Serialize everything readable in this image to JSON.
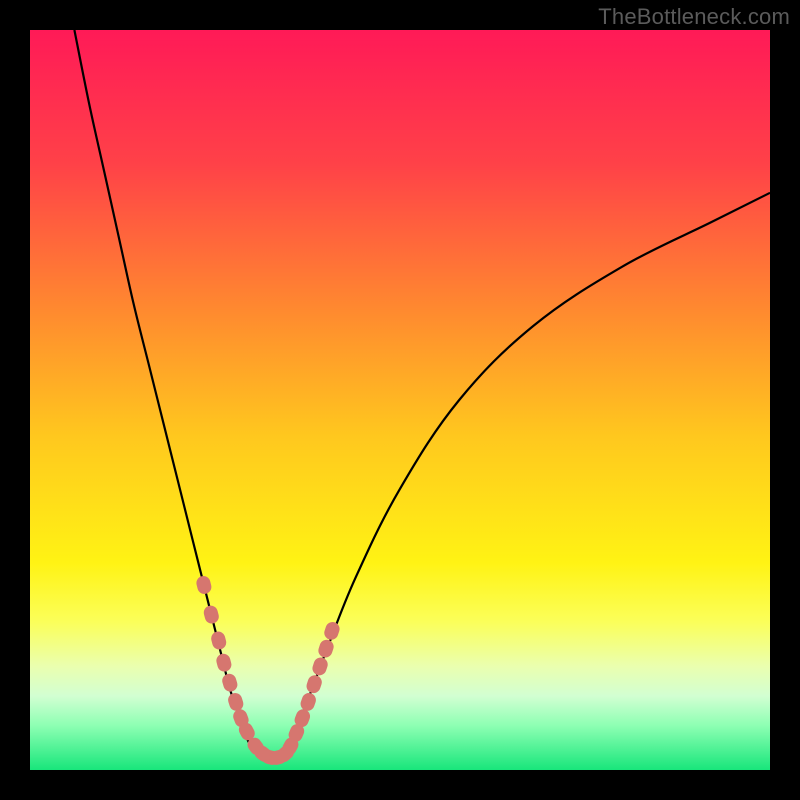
{
  "watermark": "TheBottleneck.com",
  "colors": {
    "black": "#000000",
    "curve": "#000000",
    "marker": "#d6766f",
    "gradient_stops": [
      {
        "pos": 0.0,
        "color": "#ff1a57"
      },
      {
        "pos": 0.18,
        "color": "#ff4148"
      },
      {
        "pos": 0.38,
        "color": "#ff8a2f"
      },
      {
        "pos": 0.55,
        "color": "#ffc81e"
      },
      {
        "pos": 0.72,
        "color": "#fff314"
      },
      {
        "pos": 0.8,
        "color": "#fbff5a"
      },
      {
        "pos": 0.86,
        "color": "#eaffaf"
      },
      {
        "pos": 0.9,
        "color": "#d2ffd2"
      },
      {
        "pos": 0.94,
        "color": "#8dffb3"
      },
      {
        "pos": 1.0,
        "color": "#18e67b"
      }
    ]
  },
  "chart_data": {
    "type": "line",
    "title": "",
    "xlabel": "",
    "ylabel": "",
    "xlim": [
      0,
      100
    ],
    "ylim": [
      0,
      100
    ],
    "series": [
      {
        "name": "left-branch",
        "x": [
          6,
          8,
          10,
          12,
          14,
          16,
          18,
          20,
          22,
          23,
          24,
          25,
          26,
          27,
          28,
          29,
          30
        ],
        "y": [
          100,
          90,
          81,
          72,
          63,
          55,
          47,
          39,
          31,
          27,
          23,
          19,
          15,
          11,
          8,
          5,
          3
        ]
      },
      {
        "name": "valley",
        "x": [
          30,
          31,
          32,
          33,
          34,
          35
        ],
        "y": [
          3,
          2,
          1.5,
          1.5,
          2,
          3
        ]
      },
      {
        "name": "right-branch",
        "x": [
          35,
          37,
          40,
          44,
          50,
          58,
          68,
          80,
          92,
          100
        ],
        "y": [
          3,
          8,
          16,
          26,
          38,
          50,
          60,
          68,
          74,
          78
        ]
      }
    ],
    "markers": {
      "name": "highlighted-points",
      "x": [
        23.5,
        24.5,
        25.5,
        26.2,
        27.0,
        27.8,
        28.5,
        29.3,
        30.5,
        31.5,
        32.5,
        33.5,
        34.5,
        35.2,
        36.0,
        36.8,
        37.6,
        38.4,
        39.2,
        40.0,
        40.8
      ],
      "y": [
        25.0,
        21.0,
        17.5,
        14.5,
        11.8,
        9.2,
        7.0,
        5.2,
        3.2,
        2.2,
        1.7,
        1.7,
        2.2,
        3.2,
        5.0,
        7.0,
        9.2,
        11.6,
        14.0,
        16.4,
        18.8
      ]
    }
  }
}
